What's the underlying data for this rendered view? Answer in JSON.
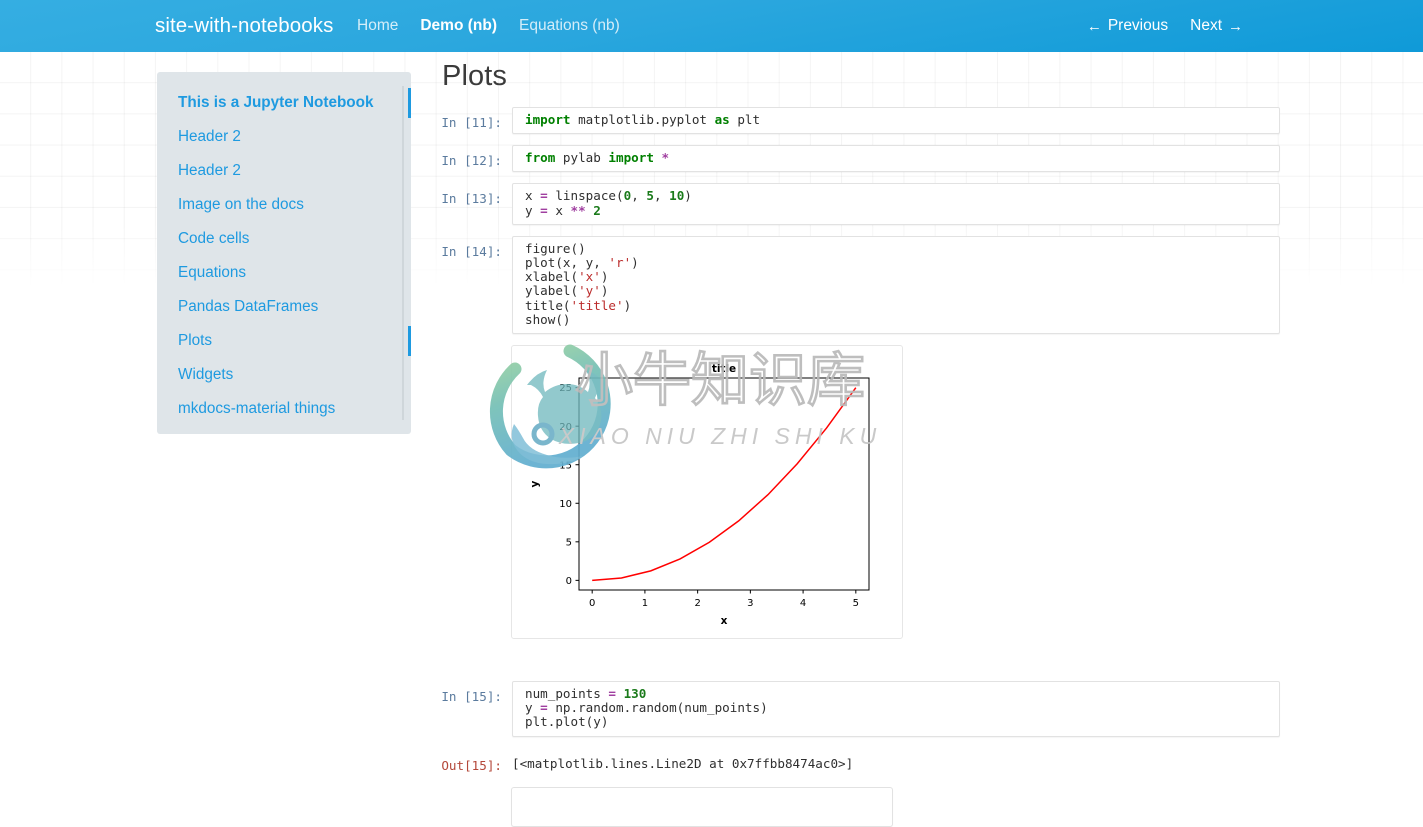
{
  "header": {
    "brand": "site-with-notebooks",
    "nav": [
      {
        "label": "Home",
        "active": false
      },
      {
        "label": "Demo (nb)",
        "active": true
      },
      {
        "label": "Equations (nb)",
        "active": false
      }
    ],
    "prev_label": "Previous",
    "next_label": "Next",
    "prev_arrow": "←",
    "next_arrow": "→",
    "bg_color": "#29a8e0",
    "text_color": "#ffffff"
  },
  "toc": {
    "accent_color": "#1e9ae0",
    "background": "#dfe5e9",
    "items": [
      {
        "label": "This is a Jupyter Notebook",
        "level": 1,
        "marked": true
      },
      {
        "label": "Header 2",
        "level": 2,
        "marked": false
      },
      {
        "label": "Header 2",
        "level": 2,
        "marked": false
      },
      {
        "label": "Image on the docs",
        "level": 2,
        "marked": false
      },
      {
        "label": "Code cells",
        "level": 2,
        "marked": false
      },
      {
        "label": "Equations",
        "level": 2,
        "marked": false
      },
      {
        "label": "Pandas DataFrames",
        "level": 2,
        "marked": false
      },
      {
        "label": "Plots",
        "level": 2,
        "marked": true
      },
      {
        "label": "Widgets",
        "level": 2,
        "marked": false
      },
      {
        "label": "mkdocs-material things",
        "level": 2,
        "marked": false
      }
    ]
  },
  "main": {
    "title": "Plots",
    "cells": [
      {
        "prompt": "In [11]:",
        "source": "import matplotlib.pyplot as plt"
      },
      {
        "prompt": "In [12]:",
        "source": "from pylab import *"
      },
      {
        "prompt": "In [13]:",
        "source": "x = linspace(0, 5, 10)\ny = x ** 2"
      },
      {
        "prompt": "In [14]:",
        "source": "figure()\nplot(x, y, 'r')\nxlabel('x')\nylabel('y')\ntitle('title')\nshow()"
      },
      {
        "prompt": "In [15]:",
        "source": "num_points = 130\ny = np.random.random(num_points)\nplt.plot(y)"
      }
    ],
    "outputs": [
      {
        "prompt": "Out[15]:",
        "text": "[<matplotlib.lines.Line2D at 0x7ffbb8474ac0>]"
      }
    ]
  },
  "watermark": {
    "text_cn": "小牛知识库",
    "text_pinyin": "XIAO NIU ZHI SHI KU",
    "ring_color_top": "#86c79a",
    "ring_color_bottom": "#6ab4cf"
  },
  "chart_data": {
    "type": "line",
    "title": "title",
    "xlabel": "x",
    "ylabel": "y",
    "xlim": [
      -0.25,
      5.25
    ],
    "ylim": [
      -1.25,
      26.25
    ],
    "xticks": [
      "0",
      "1",
      "2",
      "3",
      "4",
      "5"
    ],
    "yticks": [
      "0",
      "5",
      "10",
      "15",
      "20",
      "25"
    ],
    "grid": false,
    "legend": null,
    "series": [
      {
        "name": "y = x ** 2",
        "color": "#ff0000",
        "x": [
          0.0,
          0.5556,
          1.1111,
          1.6667,
          2.2222,
          2.7778,
          3.3333,
          3.8889,
          4.4444,
          5.0
        ],
        "y": [
          0.0,
          0.3086,
          1.2346,
          2.7778,
          4.9383,
          7.716,
          11.1111,
          15.1235,
          19.7531,
          25.0
        ]
      }
    ]
  }
}
